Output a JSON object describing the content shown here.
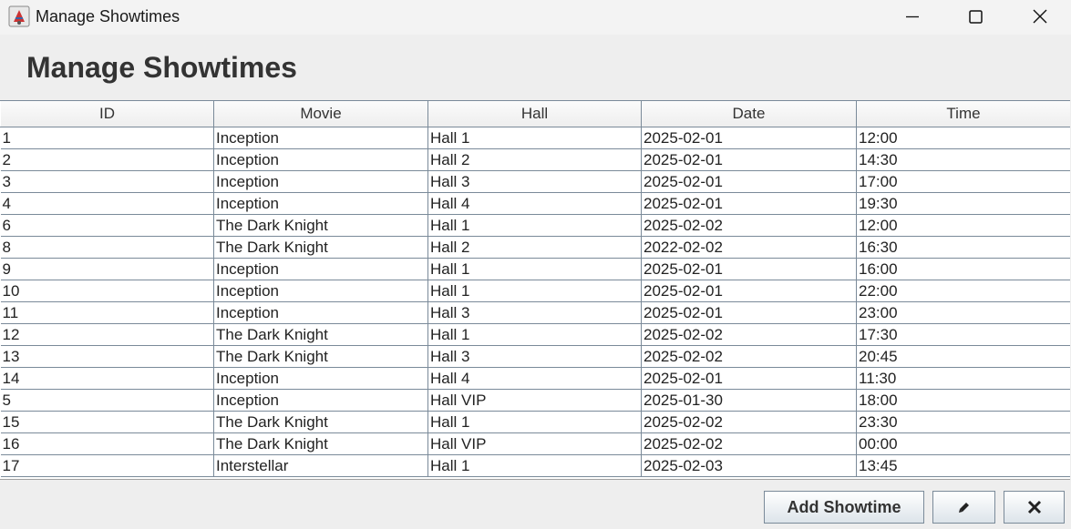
{
  "window": {
    "title": "Manage Showtimes"
  },
  "page": {
    "heading": "Manage Showtimes"
  },
  "table": {
    "columns": [
      "ID",
      "Movie",
      "Hall",
      "Date",
      "Time"
    ],
    "rows": [
      [
        "1",
        "Inception",
        "Hall 1",
        "2025-02-01",
        "12:00"
      ],
      [
        "2",
        "Inception",
        "Hall 2",
        "2025-02-01",
        "14:30"
      ],
      [
        "3",
        "Inception",
        "Hall 3",
        "2025-02-01",
        "17:00"
      ],
      [
        "4",
        "Inception",
        "Hall 4",
        "2025-02-01",
        "19:30"
      ],
      [
        "6",
        "The Dark Knight",
        "Hall 1",
        "2025-02-02",
        "12:00"
      ],
      [
        "8",
        "The Dark Knight",
        "Hall 2",
        "2022-02-02",
        "16:30"
      ],
      [
        "9",
        "Inception",
        "Hall 1",
        "2025-02-01",
        "16:00"
      ],
      [
        "10",
        "Inception",
        "Hall 1",
        "2025-02-01",
        "22:00"
      ],
      [
        "11",
        "Inception",
        "Hall 3",
        "2025-02-01",
        "23:00"
      ],
      [
        "12",
        "The Dark Knight",
        "Hall 1",
        "2025-02-02",
        "17:30"
      ],
      [
        "13",
        "The Dark Knight",
        "Hall 3",
        "2025-02-02",
        "20:45"
      ],
      [
        "14",
        "Inception",
        "Hall 4",
        "2025-02-01",
        "11:30"
      ],
      [
        "5",
        "Inception",
        "Hall VIP",
        "2025-01-30",
        "18:00"
      ],
      [
        "15",
        "The Dark Knight",
        "Hall 1",
        "2025-02-02",
        "23:30"
      ],
      [
        "16",
        "The Dark Knight",
        "Hall VIP",
        "2025-02-02",
        "00:00"
      ],
      [
        "17",
        "Interstellar",
        "Hall 1",
        "2025-02-03",
        "13:45"
      ]
    ]
  },
  "buttons": {
    "add_label": "Add Showtime",
    "edit_icon": "pencil-icon",
    "delete_icon": "x-icon"
  },
  "colors": {
    "grid_line": "#7a8a99",
    "table_bg": "#ffffff",
    "window_bg": "#eeeeee"
  }
}
